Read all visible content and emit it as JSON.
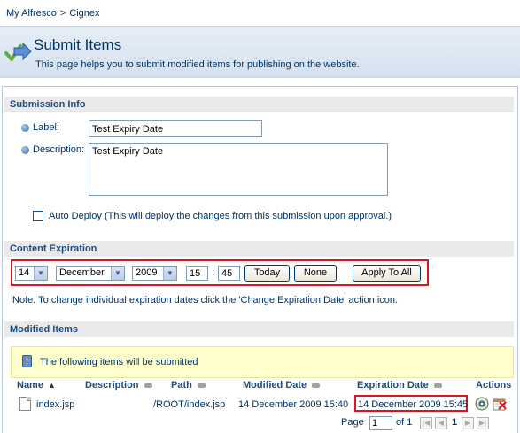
{
  "breadcrumb": {
    "items": [
      "My Alfresco",
      "Cignex"
    ],
    "separator": ">"
  },
  "header": {
    "title": "Submit Items",
    "subtitle": "This page helps you to submit modified items for publishing on the website.",
    "icon": "submit-arrow-icon"
  },
  "submission_info": {
    "title": "Submission Info",
    "label_label": "Label:",
    "label_value": "Test Expiry Date",
    "description_label": "Description:",
    "description_value": "Test Expiry Date",
    "auto_deploy_label": "Auto Deploy (This will deploy the changes from this submission upon approval.)",
    "auto_deploy_checked": false
  },
  "content_expiration": {
    "title": "Content Expiration",
    "day": "14",
    "month": "December",
    "year": "2009",
    "hour": "15",
    "time_separator": ":",
    "minute": "45",
    "today_button": "Today",
    "none_button": "None",
    "apply_all_button": "Apply To All",
    "note": "Note: To change individual expiration dates click the 'Change Expiration Date' action icon."
  },
  "modified_items": {
    "title": "Modified Items",
    "info_text": "The following items will be submitted",
    "columns": {
      "name": "Name",
      "description": "Description",
      "path": "Path",
      "modified_date": "Modified Date",
      "expiration_date": "Expiration Date",
      "actions": "Actions"
    },
    "rows": [
      {
        "name": "index.jsp",
        "description": "",
        "path": "/ROOT/index.jsp",
        "modified_date": "14 December 2009 15:40",
        "expiration_date": "14 December 2009 15:45",
        "actions": [
          "preview-icon",
          "change-expiration-date-icon"
        ]
      }
    ],
    "pager": {
      "page_label": "Page",
      "page_value": "1",
      "of_label": "of 1",
      "current_page": "1"
    }
  },
  "colors": {
    "highlight": "#d8161f",
    "info_background": "#ffffcc",
    "section_background": "#eaeaea",
    "text": "#003366"
  }
}
